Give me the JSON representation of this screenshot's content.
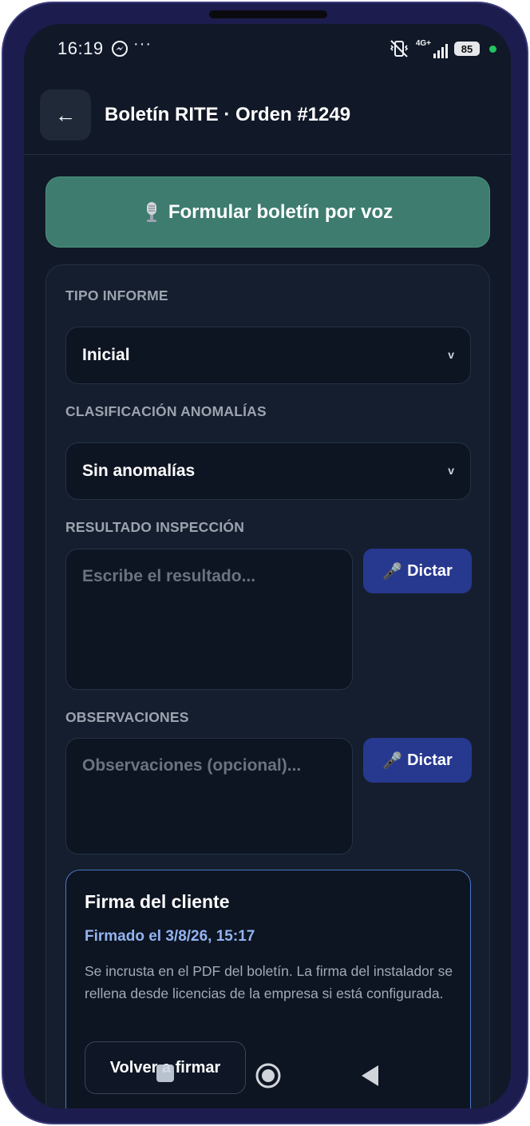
{
  "status_bar": {
    "time": "16:19",
    "more": "···",
    "network": "4G+",
    "battery": "85"
  },
  "header": {
    "back_glyph": "←",
    "title": "Boletín RITE · Orden #1249"
  },
  "voice_button": {
    "icon": "studio-microphone-icon",
    "label": "Formular boletín por voz"
  },
  "form": {
    "tipo_informe": {
      "label": "TIPO INFORME",
      "value": "Inicial"
    },
    "clasificacion": {
      "label": "CLASIFICACIÓN ANOMALÍAS",
      "value": "Sin anomalías"
    },
    "resultado": {
      "label": "RESULTADO INSPECCIÓN",
      "placeholder": "Escribe el resultado...",
      "dictar": "Dictar"
    },
    "observaciones": {
      "label": "OBSERVACIONES",
      "placeholder": "Observaciones (opcional)...",
      "dictar": "Dictar"
    }
  },
  "signature": {
    "title": "Firma del cliente",
    "signed_text": "Firmado el 3/8/26, 15:17",
    "description": "Se incrusta en el PDF del boletín. La firma del instalador se rellena desde licencias de la empresa si está configurada.",
    "redo_label": "Volver a firmar"
  },
  "colors": {
    "background": "#111827",
    "voice_button": "#3d7c6f",
    "dictar_button": "#27388f",
    "signature_border": "#4b77c9",
    "signed_text": "#93b4f0"
  }
}
